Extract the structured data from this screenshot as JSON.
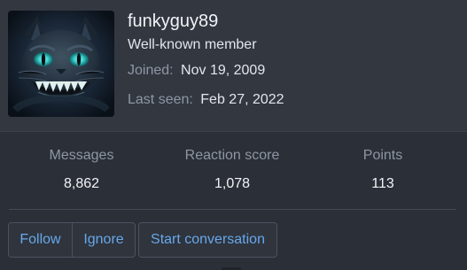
{
  "profile": {
    "username": "funkyguy89",
    "user_title": "Well-known member",
    "joined_label": "Joined:",
    "joined_value": "Nov 19, 2009",
    "last_seen_label": "Last seen:",
    "last_seen_value": "Feb 27, 2022",
    "avatar_icon": "cheshire-cat-avatar"
  },
  "stats": [
    {
      "label": "Messages",
      "value": "8,862"
    },
    {
      "label": "Reaction score",
      "value": "1,078"
    },
    {
      "label": "Points",
      "value": "113"
    }
  ],
  "actions": {
    "follow": "Follow",
    "ignore": "Ignore",
    "start_conversation": "Start conversation"
  },
  "colors": {
    "background": "#2b2f37",
    "header_background": "#323740",
    "accent": "#67a8ea",
    "muted_text": "#8f96a3",
    "border": "#4b5361"
  }
}
